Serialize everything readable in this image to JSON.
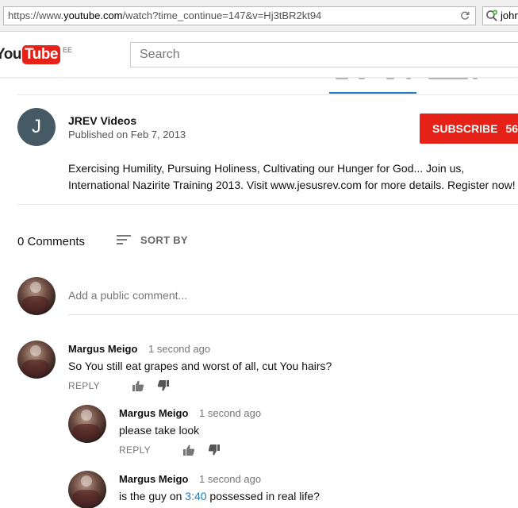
{
  "browser": {
    "url_prefix": "https://www.",
    "url_host": "youtube.com",
    "url_suffix": "/watch?time_continue=147&v=Hj3tBR2kt94",
    "search_text": "john"
  },
  "header": {
    "logo_you": "You",
    "logo_tube": "Tube",
    "logo_region": "EE",
    "search_placeholder": "Search"
  },
  "channel": {
    "avatar_letter": "J",
    "name": "JREV Videos",
    "published": "Published on Feb 7, 2013",
    "subscribe_label": "SUBSCRIBE",
    "subscriber_count": "56"
  },
  "description": {
    "line1": "Exercising Humility, Pursuing Holiness, Cultivating our Hunger for God... Join us,",
    "line2": "International Nazirite Training 2013. Visit www.jesusrev.com for more details. Register now!"
  },
  "comments_section": {
    "count_label": "0 Comments",
    "sort_label": "SORT BY",
    "add_placeholder": "Add a public comment..."
  },
  "comments": [
    {
      "author": "Margus Meigo",
      "time": "1 second ago",
      "text": "So You still eat grapes and worst of all, cut You hairs?",
      "reply_label": "REPLY"
    },
    {
      "author": "Margus Meigo",
      "time": "1 second ago",
      "text": "please take look",
      "reply_label": "REPLY"
    },
    {
      "author": "Margus Meigo",
      "time": "1 second ago",
      "text_before": "is the guy on ",
      "timestamp_link": "3:40",
      "text_after": " possessed in real life?"
    }
  ],
  "colors": {
    "brand_red": "#e62117",
    "link_blue": "#167ac6",
    "channel_avatar_bg": "#455a64"
  },
  "icons": [
    "refresh-icon",
    "search-icon",
    "sort-icon",
    "thumbs-up-icon",
    "thumbs-down-icon"
  ]
}
